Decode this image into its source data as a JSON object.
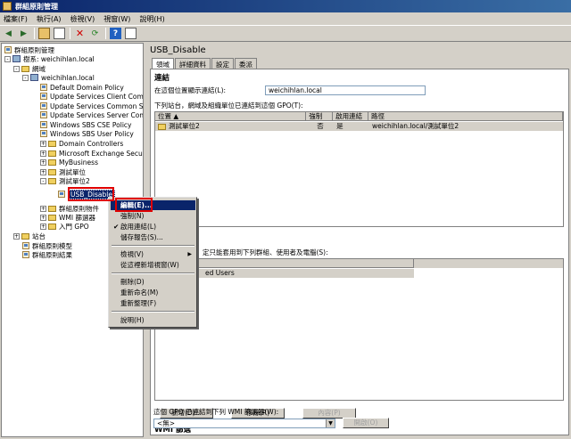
{
  "window": {
    "title": "群組原則管理"
  },
  "menubar": {
    "items": [
      "檔案(F)",
      "執行(A)",
      "檢視(V)",
      "視窗(W)",
      "說明(H)"
    ]
  },
  "toolbar": {
    "icons": [
      "back-arrow-icon",
      "forward-arrow-icon",
      "up-folder-icon",
      "properties-icon",
      "delete-icon",
      "refresh-icon",
      "help-icon",
      "details-icon"
    ]
  },
  "tree": {
    "items": [
      {
        "label": "群組原則管理",
        "icon": "gpm-icon",
        "exp": ""
      },
      {
        "label": "樹系: weichihlan.local",
        "icon": "forest-icon",
        "exp": "-"
      },
      {
        "label": "網域",
        "icon": "folder-icon",
        "exp": "-"
      },
      {
        "label": "weichihlan.local",
        "icon": "domain-icon",
        "exp": "-"
      },
      {
        "label": "Default Domain Policy",
        "icon": "gpo-link-icon",
        "exp": ""
      },
      {
        "label": "Update Services Client Com",
        "icon": "gpo-link-icon",
        "exp": ""
      },
      {
        "label": "Update Services Common S",
        "icon": "gpo-link-icon",
        "exp": ""
      },
      {
        "label": "Update Services Server Com",
        "icon": "gpo-link-icon",
        "exp": ""
      },
      {
        "label": "Windows SBS CSE Policy",
        "icon": "gpo-link-icon",
        "exp": ""
      },
      {
        "label": "Windows SBS User Policy",
        "icon": "gpo-link-icon",
        "exp": ""
      },
      {
        "label": "Domain Controllers",
        "icon": "ou-icon",
        "exp": "+"
      },
      {
        "label": "Microsoft Exchange Securit",
        "icon": "ou-icon",
        "exp": "+"
      },
      {
        "label": "MyBusiness",
        "icon": "ou-icon",
        "exp": "+"
      },
      {
        "label": "測試單位",
        "icon": "ou-icon",
        "exp": "+"
      },
      {
        "label": "測試單位2",
        "icon": "ou-icon",
        "exp": "-"
      },
      {
        "label": "USB_Disable",
        "icon": "gpo-link-icon",
        "exp": ""
      },
      {
        "label": "群組原則物件",
        "icon": "folder-icon",
        "exp": "+"
      },
      {
        "label": "WMI 篩選器",
        "icon": "folder-icon",
        "exp": "+"
      },
      {
        "label": "入門 GPO",
        "icon": "folder-icon",
        "exp": "+"
      },
      {
        "label": "站台",
        "icon": "sites-icon",
        "exp": "+"
      },
      {
        "label": "群組原則模型",
        "icon": "model-icon",
        "exp": ""
      },
      {
        "label": "群組原則結果",
        "icon": "results-icon",
        "exp": ""
      }
    ]
  },
  "gpo": {
    "title": "USB_Disable",
    "tabs": [
      "領域",
      "詳細資料",
      "設定",
      "委派"
    ],
    "links_heading": "連結",
    "location_label": "在這個位置顯示連結(L):",
    "location_value": "weichihlan.local",
    "links_desc": "下列站台，網域及組織單位已連結到這個 GPO(T):",
    "links_columns": [
      "位置",
      "強制",
      "啟用連結",
      "路徑"
    ],
    "links_rows": [
      {
        "location": "測試單位2",
        "enforced": "否",
        "enabled": "是",
        "path": "weichihlan.local/測試單位2"
      }
    ],
    "filter_desc_partial": "定只能套用到下列群組、使用者及電腦(S):",
    "filter_row_partial": "ed Users",
    "add_btn": "新增(D)...",
    "remove_btn": "移除(R)",
    "props_btn": "內容(P)",
    "wmi_heading": "WMI 篩選",
    "wmi_desc": "這個 GPO 已連結到下列 WMI 篩選器(W):",
    "wmi_value": "<無>",
    "open_btn": "開啟(O)"
  },
  "context_menu": {
    "items": [
      {
        "label": "編輯(E)...",
        "check": "",
        "sub": ""
      },
      {
        "label": "強制(N)",
        "check": "",
        "sub": ""
      },
      {
        "label": "啟用連結(L)",
        "check": "✔",
        "sub": ""
      },
      {
        "label": "儲存報告(S)...",
        "check": "",
        "sub": ""
      },
      {
        "label": "檢視(V)",
        "check": "",
        "sub": "▶"
      },
      {
        "label": "從這裡新增視窗(W)",
        "check": "",
        "sub": ""
      },
      {
        "label": "刪除(D)",
        "check": "",
        "sub": ""
      },
      {
        "label": "重新命名(M)",
        "check": "",
        "sub": ""
      },
      {
        "label": "重新整理(F)",
        "check": "",
        "sub": ""
      },
      {
        "label": "說明(H)",
        "check": "",
        "sub": ""
      }
    ]
  }
}
